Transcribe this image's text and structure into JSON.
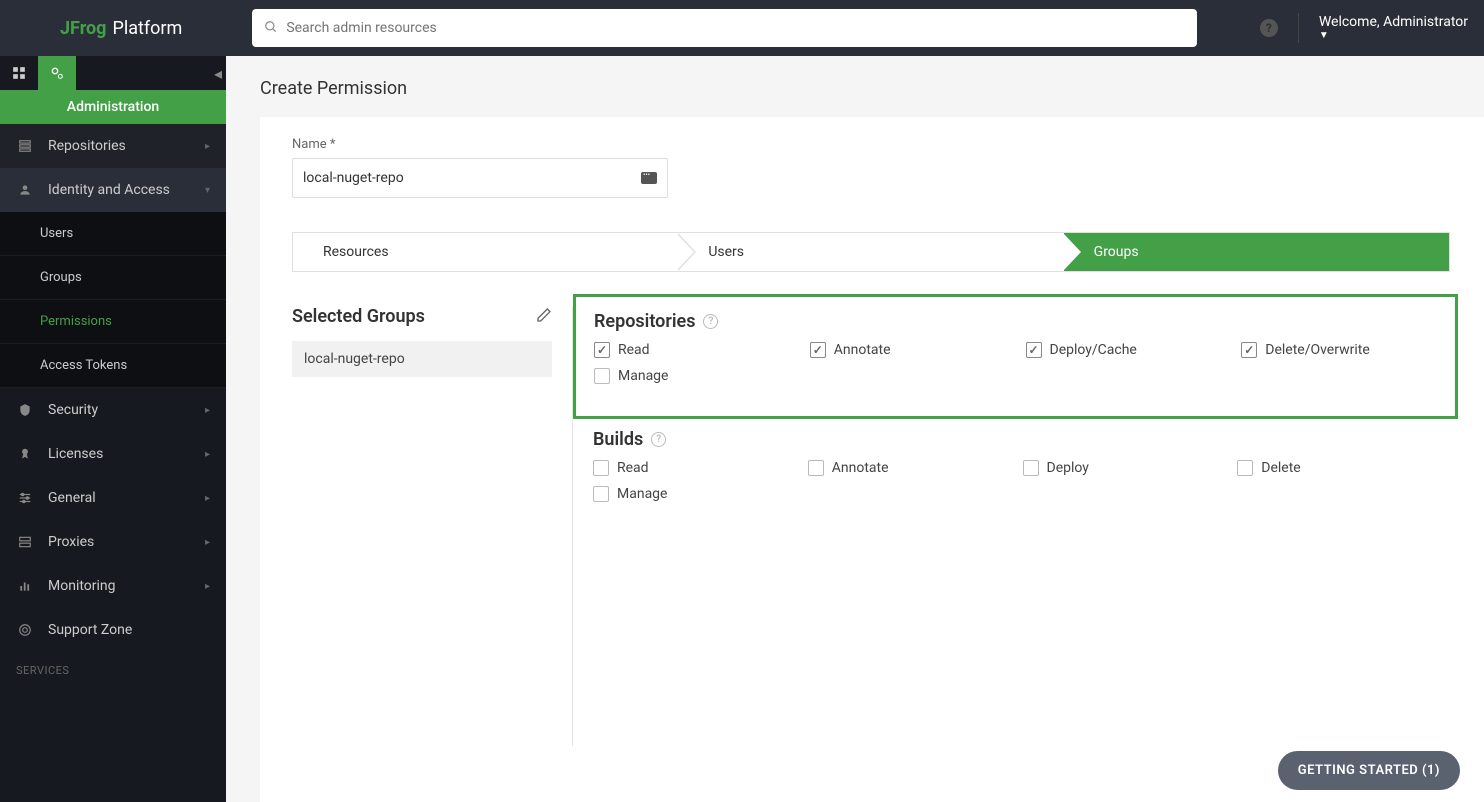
{
  "header": {
    "logo_brand": "JFrog",
    "logo_product": "Platform",
    "search_placeholder": "Search admin resources",
    "welcome": "Welcome, Administrator"
  },
  "sidebar": {
    "admin_label": "Administration",
    "items": [
      {
        "label": "Repositories"
      },
      {
        "label": "Identity and Access"
      },
      {
        "label": "Security"
      },
      {
        "label": "Licenses"
      },
      {
        "label": "General"
      },
      {
        "label": "Proxies"
      },
      {
        "label": "Monitoring"
      },
      {
        "label": "Support Zone"
      }
    ],
    "sub_identity": [
      {
        "label": "Users"
      },
      {
        "label": "Groups"
      },
      {
        "label": "Permissions"
      },
      {
        "label": "Access Tokens"
      }
    ],
    "services_label": "SERVICES"
  },
  "page": {
    "title": "Create Permission",
    "name_label": "Name *",
    "name_value": "local-nuget-repo",
    "steps": [
      "Resources",
      "Users",
      "Groups"
    ],
    "selected_groups_title": "Selected Groups",
    "selected_group_item": "local-nuget-repo",
    "sections": {
      "repositories": {
        "title": "Repositories",
        "perms": [
          {
            "label": "Read",
            "checked": true
          },
          {
            "label": "Annotate",
            "checked": true
          },
          {
            "label": "Deploy/Cache",
            "checked": true
          },
          {
            "label": "Delete/Overwrite",
            "checked": true
          },
          {
            "label": "Manage",
            "checked": false
          }
        ]
      },
      "builds": {
        "title": "Builds",
        "perms": [
          {
            "label": "Read",
            "checked": false
          },
          {
            "label": "Annotate",
            "checked": false
          },
          {
            "label": "Deploy",
            "checked": false
          },
          {
            "label": "Delete",
            "checked": false
          },
          {
            "label": "Manage",
            "checked": false
          }
        ]
      }
    }
  },
  "getting_started": "GETTING STARTED (1)"
}
